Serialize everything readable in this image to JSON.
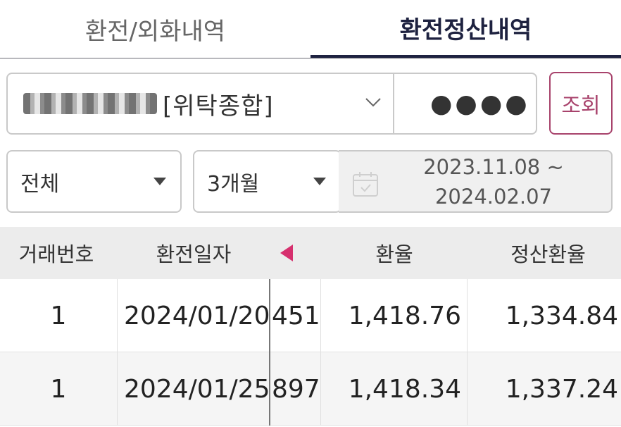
{
  "tabs": [
    {
      "label": "환전/외화내역",
      "active": false
    },
    {
      "label": "환전정산내역",
      "active": true
    }
  ],
  "account": {
    "type": "[위탁종합]",
    "password_mask": "●●●●"
  },
  "inquire_button": "조회",
  "filters": {
    "type": "전체",
    "period": "3개월",
    "date_from": "2023.11.08 ~",
    "date_to": "2024.02.07"
  },
  "table": {
    "headers": [
      "거래번호",
      "환전일자",
      "환율",
      "정산환율"
    ],
    "rows": [
      {
        "no": "1",
        "date": "2024/01/20",
        "partial": "451",
        "rate": "1,418.76",
        "settle_rate": "1,334.84"
      },
      {
        "no": "1",
        "date": "2024/01/25",
        "partial": "897",
        "rate": "1,418.34",
        "settle_rate": "1,337.24"
      }
    ]
  },
  "colors": {
    "accent": "#a8436c",
    "active_tab": "#1e2240",
    "scroll_arrow": "#d6306e"
  },
  "icons": [
    "chevron-down-icon",
    "caret-down-icon",
    "calendar-icon",
    "scroll-left-arrow-icon"
  ]
}
